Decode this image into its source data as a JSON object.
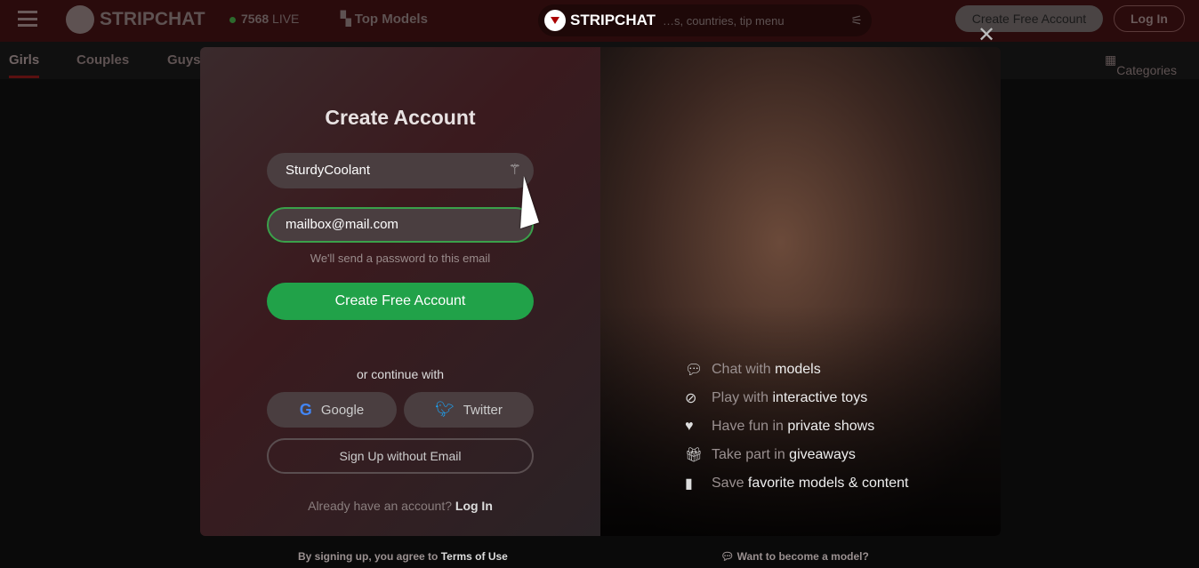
{
  "topbar": {
    "logo": "STRIPCHAT",
    "live_count": "7568",
    "live_label": "LIVE",
    "top_models": "Top Models",
    "search_placeholder": "…s, countries, tip menu",
    "create_account": "Create Free Account",
    "login": "Log In"
  },
  "subnav": {
    "tabs": [
      "Girls",
      "Couples",
      "Guys"
    ],
    "categories": "Categories"
  },
  "modal": {
    "logo": "STRIPCHAT",
    "title": "Create Account",
    "username": "SturdyCoolant",
    "email": "mailbox@mail.com",
    "email_hint": "We'll send a password to this email",
    "submit": "Create Free Account",
    "or_continue": "or continue with",
    "google": "Google",
    "twitter": "Twitter",
    "no_email": "Sign Up without Email",
    "already": "Already have an account?",
    "login": "Log In",
    "features": [
      {
        "icon": "chat-icon",
        "dim": "Chat with",
        "bold": "models"
      },
      {
        "icon": "toy-icon",
        "dim": "Play with",
        "bold": "interactive toys"
      },
      {
        "icon": "heart-icon",
        "dim": "Have fun in",
        "bold": "private shows"
      },
      {
        "icon": "gift-icon",
        "dim": "Take part in",
        "bold": "giveaways"
      },
      {
        "icon": "bookmark-icon",
        "dim": "Save",
        "bold": "favorite models & content"
      }
    ]
  },
  "footer": {
    "terms_prefix": "By signing up, you agree to",
    "terms": "Terms of Use",
    "model": "Want to become a model?"
  },
  "colors": {
    "accent_green": "#21a249",
    "topbar": "#2a0b0c"
  }
}
